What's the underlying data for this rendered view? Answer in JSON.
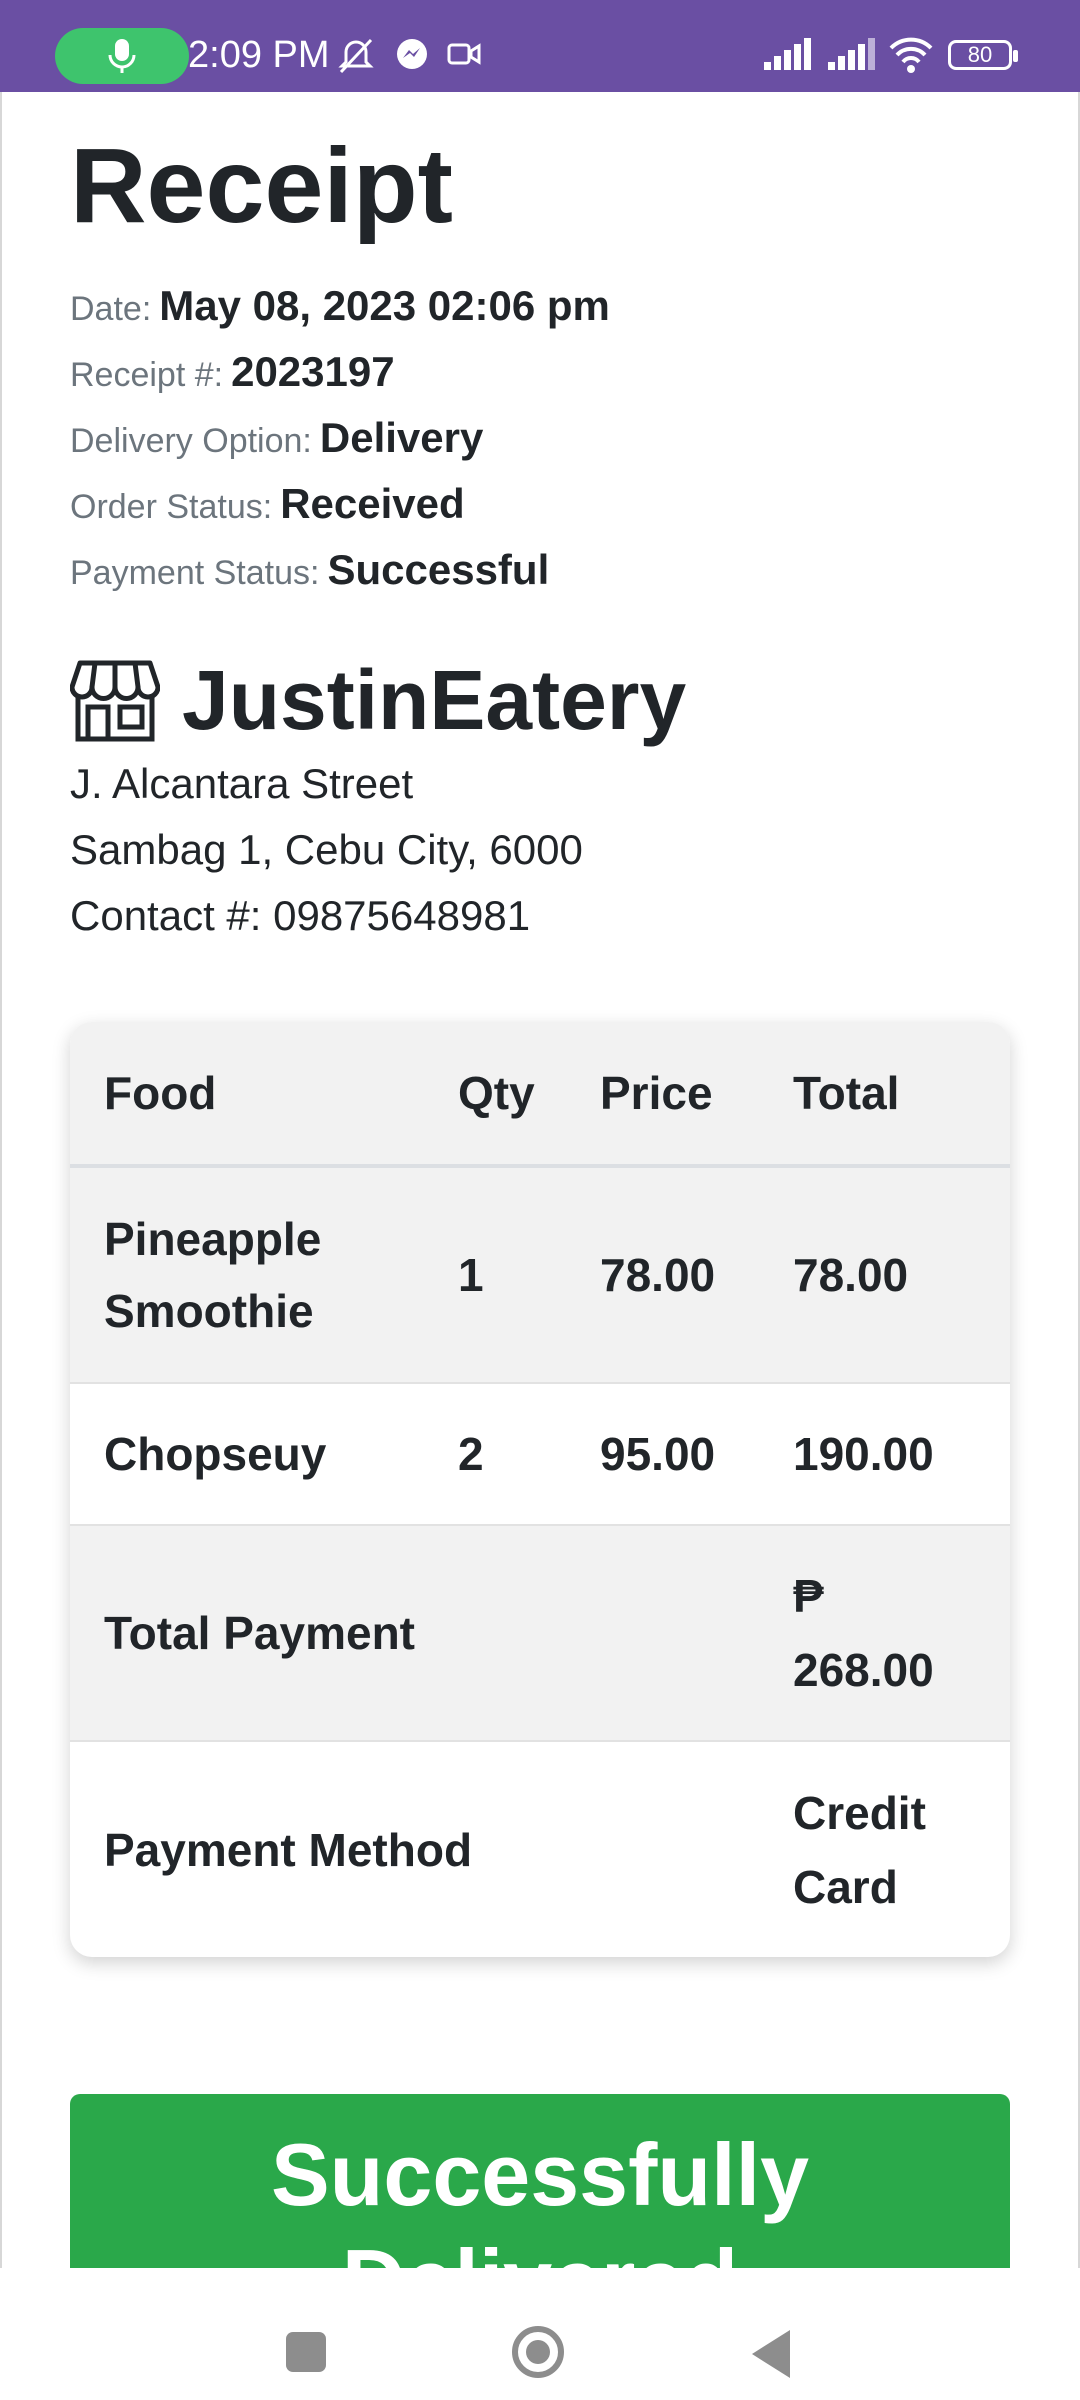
{
  "status_bar": {
    "time": "2:09 PM",
    "battery": "80",
    "icons": [
      "microphone-icon",
      "mute-icon",
      "messenger-icon",
      "video-icon",
      "signal-icon",
      "signal-icon",
      "wifi-icon",
      "battery-icon"
    ],
    "background": "#6a4fa3"
  },
  "receipt": {
    "title": "Receipt",
    "date_label": "Date:",
    "date_value": "May 08, 2023 02:06 pm",
    "number_label": "Receipt #:",
    "number_value": "2023197",
    "delivery_label": "Delivery Option:",
    "delivery_value": "Delivery",
    "order_status_label": "Order Status:",
    "order_status_value": "Received",
    "payment_status_label": "Payment Status:",
    "payment_status_value": "Successful"
  },
  "store": {
    "icon": "store-icon",
    "name": "JustinEatery",
    "address_line1": "J. Alcantara Street",
    "address_line2": "Sambag 1, Cebu City, 6000",
    "contact": "Contact #: 09875648981"
  },
  "table": {
    "headers": [
      "Food",
      "Qty",
      "Price",
      "Total"
    ],
    "rows": [
      {
        "food": "Pineapple Smoothie",
        "qty": "1",
        "price": "78.00",
        "total": "78.00"
      },
      {
        "food": "Chopseuy",
        "qty": "2",
        "price": "95.00",
        "total": "190.00"
      }
    ],
    "total_payment_label": "Total Payment",
    "total_payment_currency": "₱",
    "total_payment_value": "268.00",
    "payment_method_label": "Payment Method",
    "payment_method_value": "Credit Card"
  },
  "status_button": {
    "label": "Successfully Delivered",
    "color": "#2aa84a"
  },
  "nav": {
    "icons": [
      "recent-apps-icon",
      "home-icon",
      "back-icon"
    ]
  }
}
